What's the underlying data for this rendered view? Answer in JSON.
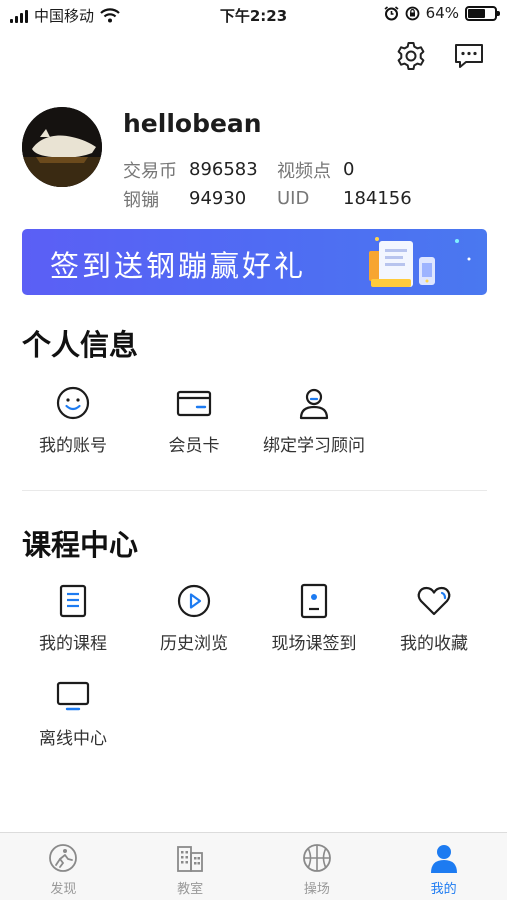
{
  "status_bar": {
    "carrier": "中国移动",
    "time": "下午2:23",
    "battery_percent": "64%",
    "battery_level": 0.64
  },
  "profile": {
    "username": "hellobean",
    "coins_label": "交易币",
    "coins_value": "896583",
    "video_points_label": "视频点",
    "video_points_value": "0",
    "gang_label": "钢镚",
    "gang_value": "94930",
    "uid_label": "UID",
    "uid_value": "184156"
  },
  "banner": {
    "text": "签到送钢蹦赢好礼"
  },
  "personal_info": {
    "title": "个人信息",
    "items": [
      {
        "label": "我的账号",
        "icon": "smile-icon"
      },
      {
        "label": "会员卡",
        "icon": "card-icon"
      },
      {
        "label": "绑定学习顾问",
        "icon": "advisor-icon"
      }
    ]
  },
  "course_center": {
    "title": "课程中心",
    "items": [
      {
        "label": "我的课程",
        "icon": "document-icon"
      },
      {
        "label": "历史浏览",
        "icon": "play-icon"
      },
      {
        "label": "现场课签到",
        "icon": "badge-icon"
      },
      {
        "label": "我的收藏",
        "icon": "heart-icon"
      },
      {
        "label": "离线中心",
        "icon": "monitor-icon"
      }
    ]
  },
  "tabbar": {
    "tabs": [
      {
        "label": "发现",
        "icon": "discover-icon",
        "active": false
      },
      {
        "label": "教室",
        "icon": "building-icon",
        "active": false
      },
      {
        "label": "操场",
        "icon": "basketball-icon",
        "active": false
      },
      {
        "label": "我的",
        "icon": "person-icon",
        "active": true
      }
    ]
  },
  "colors": {
    "accent": "#1d7bf1",
    "banner_start": "#5b5ff5",
    "banner_end": "#4a78f0"
  }
}
